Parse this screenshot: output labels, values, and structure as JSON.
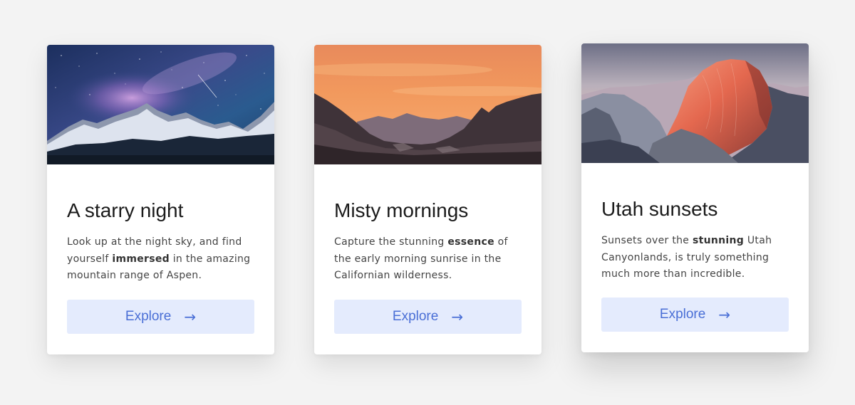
{
  "cards": [
    {
      "title": "A starry night",
      "text_parts": [
        "Look up at the night sky, and find yourself ",
        "immersed",
        " in the amazing mountain range of Aspen."
      ],
      "button_label": "Explore",
      "button_icon": "arrow-right-icon",
      "image_subject": "starry-night-mountains"
    },
    {
      "title": "Misty mornings",
      "text_parts": [
        "Capture the stunning ",
        "essence",
        " of the early morning sunrise in the Californian wilderness."
      ],
      "button_label": "Explore",
      "button_icon": "arrow-right-icon",
      "image_subject": "sunrise-mountains"
    },
    {
      "title": "Utah sunsets",
      "text_parts": [
        "Sunsets over the ",
        "stunning",
        " Utah Canyonlands, is truly something much more than incredible."
      ],
      "button_label": "Explore",
      "button_icon": "arrow-right-icon",
      "image_subject": "half-dome-sunset"
    }
  ],
  "colors": {
    "background": "#f3f3f3",
    "card": "#ffffff",
    "button_bg": "#e4ebfd",
    "button_text": "#4a6fd6",
    "title": "#1b1b1b",
    "body_text": "#444444"
  }
}
